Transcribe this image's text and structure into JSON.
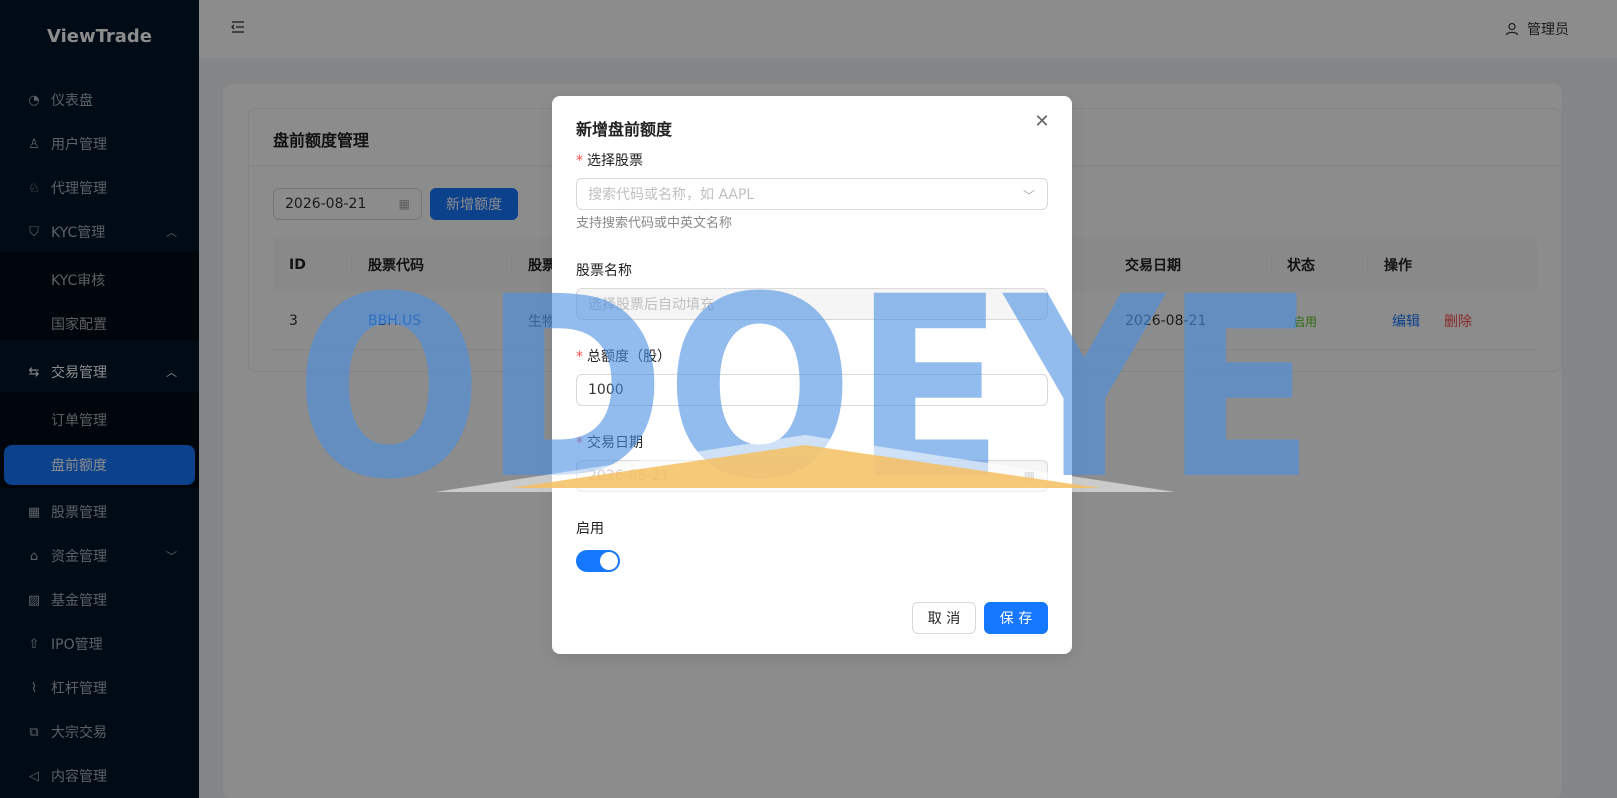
{
  "sidebar": {
    "logo": "ViewTrade",
    "items": [
      {
        "label": "仪表盘",
        "icon": "dashboard-icon"
      },
      {
        "label": "用户管理",
        "icon": "user-icon"
      },
      {
        "label": "代理管理",
        "icon": "agent-icon"
      },
      {
        "label": "KYC管理",
        "icon": "shield-icon"
      },
      {
        "label": "KYC审核"
      },
      {
        "label": "国家配置"
      },
      {
        "label": "交易管理",
        "icon": "swap-icon"
      },
      {
        "label": "订单管理"
      },
      {
        "label": "盘前额度"
      },
      {
        "label": "股票管理",
        "icon": "grid-icon"
      },
      {
        "label": "资金管理",
        "icon": "bank-icon"
      },
      {
        "label": "基金管理",
        "icon": "fund-chart-icon"
      },
      {
        "label": "IPO管理",
        "icon": "rocket-icon"
      },
      {
        "label": "杠杆管理",
        "icon": "line-chart-icon"
      },
      {
        "label": "大宗交易",
        "icon": "block-icon"
      },
      {
        "label": "内容管理",
        "icon": "notification-icon"
      }
    ]
  },
  "header": {
    "user": "管理员"
  },
  "page": {
    "title": "盘前额度管理",
    "date_filter": "2026-08-21",
    "add_button": "新增额度",
    "columns": [
      "ID",
      "股票代码",
      "股票",
      "交易日期",
      "状态",
      "操作"
    ],
    "rows": [
      {
        "id": "3",
        "code": "BBH.US",
        "name": "生物",
        "date": "2026-08-21",
        "status": "启用",
        "edit": "编辑",
        "delete": "删除"
      }
    ]
  },
  "modal": {
    "title": "新增盘前额度",
    "stock_label": "选择股票",
    "stock_placeholder": "搜索代码或名称，如 AAPL",
    "stock_help": "支持搜索代码或中英文名称",
    "name_label": "股票名称",
    "name_placeholder": "选择股票后自动填充",
    "quota_label": "总额度（股）",
    "quota_value": "1000",
    "date_label": "交易日期",
    "date_value": "2026-08-21",
    "enabled_label": "启用",
    "enabled": true,
    "cancel": "取 消",
    "save": "保 存"
  },
  "watermark": "ODOEYE",
  "colors": {
    "primary": "#1677ff",
    "sidebar_bg": "#001529",
    "danger": "#ff4d4f",
    "success": "#52c41a"
  }
}
